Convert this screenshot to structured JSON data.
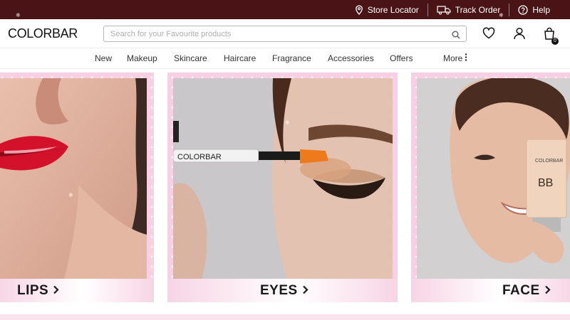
{
  "topbar": {
    "store_locator": "Store Locator",
    "track_order": "Track Order",
    "help": "Help"
  },
  "header": {
    "logo": "COLORBAR",
    "search_placeholder": "Search for your Favourite products",
    "cart_count": "0"
  },
  "nav": {
    "items": [
      "New",
      "Makeup",
      "Skincare",
      "Haircare",
      "Fragrance",
      "Accessories",
      "Offers"
    ],
    "more": "More"
  },
  "cards": [
    {
      "label": "LIPS"
    },
    {
      "label": "EYES"
    },
    {
      "label": "FACE"
    }
  ],
  "product_text": {
    "brush_brand": "COLORBAR",
    "tube_brand": "COLORBAR",
    "tube_name": "BB"
  },
  "colors": {
    "topbar_bg": "#4a1416",
    "card_frame": "#f8cfe3",
    "accent_lip": "#e0102a"
  }
}
